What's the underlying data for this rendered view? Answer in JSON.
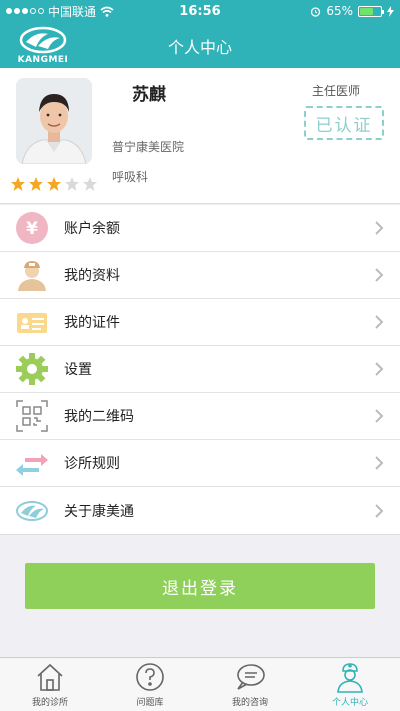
{
  "status_bar": {
    "carrier": "中国联通",
    "time": "16:56",
    "battery": "65%",
    "battery_level": 0.65
  },
  "nav": {
    "logo_text": "KANGMEI",
    "title": "个人中心"
  },
  "profile": {
    "name": "苏麒",
    "title": "主任医师",
    "verified": "已认证",
    "hospital": "普宁康美医院",
    "department": "呼吸科",
    "rating": 3,
    "rating_max": 5
  },
  "menu": {
    "items": [
      {
        "label": "账户余额",
        "icon": "yen-icon"
      },
      {
        "label": "我的资料",
        "icon": "doctor-profile-icon"
      },
      {
        "label": "我的证件",
        "icon": "id-card-icon"
      },
      {
        "label": "设置",
        "icon": "gear-icon"
      },
      {
        "label": "我的二维码",
        "icon": "qr-code-icon"
      },
      {
        "label": "诊所规则",
        "icon": "exchange-arrows-icon"
      },
      {
        "label": "关于康美通",
        "icon": "kangmei-logo-icon"
      }
    ]
  },
  "logout_label": "退出登录",
  "tabs": [
    {
      "label": "我的诊所",
      "icon": "house-icon"
    },
    {
      "label": "问题库",
      "icon": "question-icon"
    },
    {
      "label": "我的咨询",
      "icon": "chat-icon"
    },
    {
      "label": "个人中心",
      "icon": "doctor-icon"
    }
  ],
  "colors": {
    "brand": "#2fb3b8",
    "logout": "#8fd05a",
    "star": "#f5a623"
  }
}
